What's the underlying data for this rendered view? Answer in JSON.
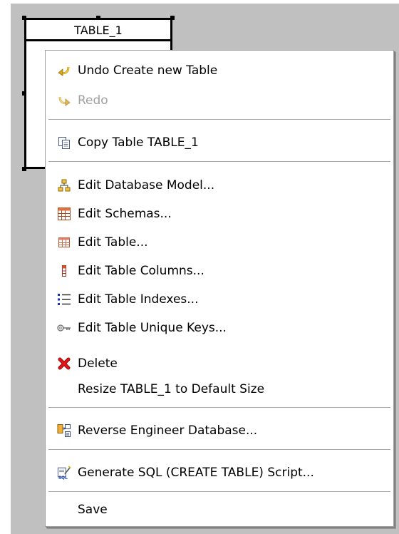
{
  "table": {
    "name": "TABLE_1"
  },
  "menu": {
    "undo": "Undo Create new Table",
    "redo": "Redo",
    "copy": "Copy Table TABLE_1",
    "edit_model": "Edit Database Model...",
    "edit_schemas": "Edit Schemas...",
    "edit_table": "Edit Table...",
    "edit_columns": "Edit Table Columns...",
    "edit_indexes": "Edit Table Indexes...",
    "edit_unique_keys": "Edit Table Unique Keys...",
    "delete": "Delete",
    "resize": "Resize TABLE_1 to Default Size",
    "reverse_engineer": "Reverse Engineer Database...",
    "generate_sql": "Generate SQL (CREATE TABLE) Script...",
    "save": "Save"
  },
  "icons": {
    "undo": "undo-arrow-icon",
    "redo": "redo-arrow-icon",
    "copy": "copy-icon",
    "edit_model": "database-model-icon",
    "edit_schemas": "schemas-icon",
    "edit_table": "table-icon",
    "edit_columns": "column-icon",
    "edit_indexes": "index-list-icon",
    "edit_unique_keys": "key-icon",
    "delete": "delete-x-icon",
    "reverse_engineer": "reverse-engineer-icon",
    "generate_sql": "sql-script-icon"
  },
  "colors": {
    "canvas": "#c0c0c0",
    "delete_red": "#e01818",
    "disabled_text": "#a0a0a0"
  }
}
